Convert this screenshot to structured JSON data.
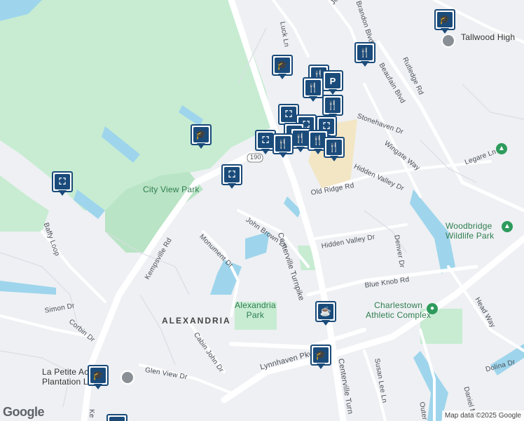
{
  "map": {
    "labels": {
      "city_view_park": "City View Park",
      "alexandria": "ALEXANDRIA",
      "alexandria_park": "Alexandria\nPark",
      "charlestown": "Charlestown\nAthletic Complex",
      "woodbridge": "Woodbridge\nWildlife Park",
      "tallwood": "Tallwood High",
      "la_petite": "La Petite Acad\nPlantation Lake",
      "centerville_turnpike": "Centerville Turnpike",
      "centerville_turn2": "Centerville Turn",
      "kempsville": "Kempsville Rd",
      "john_brown": "John Brown Ln",
      "monument": "Monument Dr",
      "old_ridge": "Old Ridge Rd",
      "hidden_valley1": "Hidden Valley Dr",
      "hidden_valley2": "Hidden Valley Dr",
      "hidden_valley3": "Hidden Valley Dr",
      "blue_knob": "Blue Knob Rd",
      "denver": "Denver Dr",
      "stonehaven": "Stonehaven Dr",
      "wingate": "Wingate Way",
      "legare": "Legare Ln",
      "rutledge": "Rutledge Rd",
      "beaufain": "Beaufain Blvd",
      "brandon": "Brandon Blvd",
      "joplin": "Joplin Ln",
      "luck": "Luck Ln",
      "baffy": "Baffy Loop",
      "simon": "Simon Dr",
      "corbin": "Corbin Dr",
      "cabin_john": "Cabin John Dr",
      "glen_view": "Glen View Dr",
      "lynnhaven": "Lynnhaven Pkwy",
      "susan_lee": "Susan Lee Ln",
      "head_way": "Head Way",
      "dolina": "Dolina Dr",
      "daniel": "Daniel M",
      "route": "190",
      "kempsville_bottom": "Ke",
      "outer": "Outer"
    },
    "attribution": "Map data ©2025 Google",
    "logo": "Google",
    "icons": {
      "school": "graduation-cap-icon",
      "shopping": "shopping-bag-icon",
      "restaurant": "fork-knife-icon",
      "cafe": "coffee-cup-icon",
      "parking": "parking-icon"
    },
    "colors": {
      "park": "#c7ecd2",
      "water": "#9ed5ec",
      "road": "#ffffff",
      "pin": "#1a4b7a",
      "commercial": "#f3e6c4"
    }
  }
}
